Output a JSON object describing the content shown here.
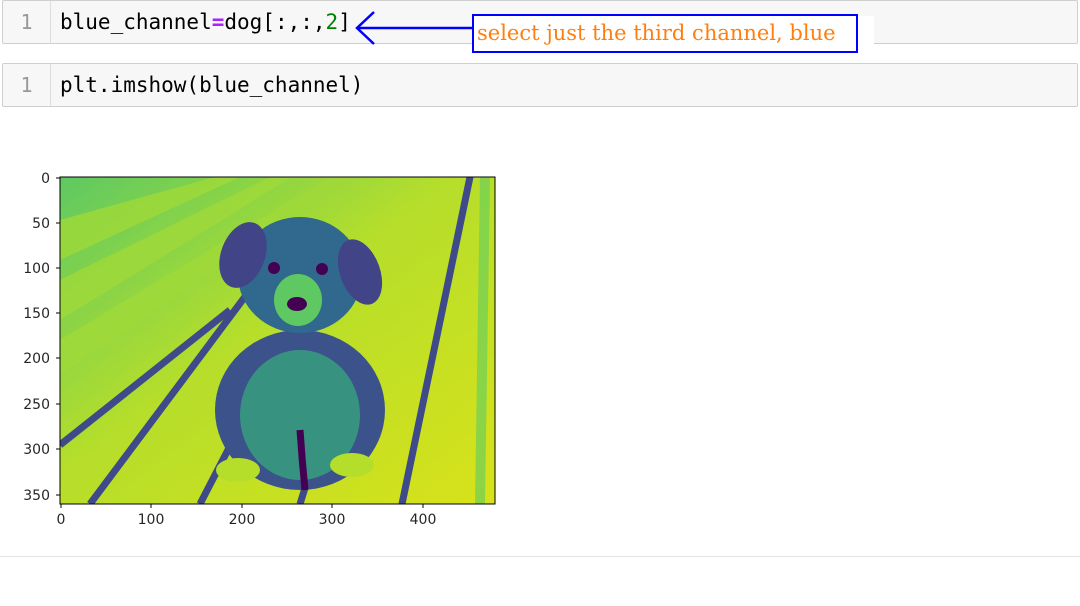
{
  "cells": [
    {
      "line_number": "1",
      "code": {
        "var": "blue_channel",
        "op": "=",
        "expr": "dog[:,:,",
        "num": "2",
        "close": "]"
      }
    },
    {
      "line_number": "1",
      "code": "plt.imshow(blue_channel)"
    }
  ],
  "annotation": {
    "text": "select just the third channel, blue",
    "text_color": "#ff7f0e",
    "border_color": "#0000ff"
  },
  "plot": {
    "colormap": "viridis",
    "image_description": "single-channel (blue) image of a puppy sitting on striped floor boards",
    "x_ticks": [
      "0",
      "100",
      "200",
      "300",
      "400"
    ],
    "y_ticks": [
      "0",
      "50",
      "100",
      "150",
      "200",
      "250",
      "300",
      "350"
    ]
  },
  "colors": {
    "cell_background": "#f7f7f7",
    "keyword_operator": "#aa22ff",
    "number_literal": "#008000"
  }
}
